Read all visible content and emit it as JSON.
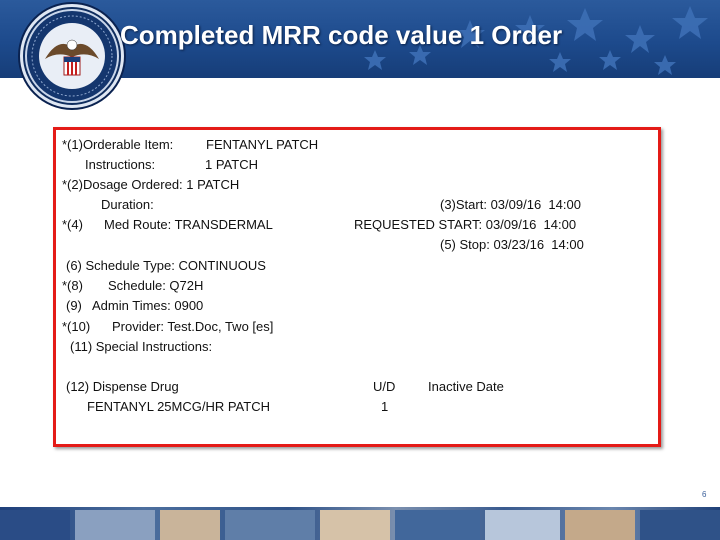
{
  "header": {
    "title": "Completed MRR code value 1 Order",
    "seal_icon": "va-department-seal-icon"
  },
  "order": {
    "line1_prefix": "*(1)Orderable Item:",
    "line1_value": "FENTANYL PATCH",
    "line2_prefix": "Instructions:",
    "line2_value": "1 PATCH",
    "line3": "*(2)Dosage Ordered: 1 PATCH",
    "line4": "Duration:",
    "start": "(3)Start: 03/09/16  14:00",
    "line5_prefix": "*(4)",
    "line5_value": "Med Route: TRANSDERMAL",
    "requested_start": "REQUESTED START: 03/09/16  14:00",
    "stop": "(5) Stop: 03/23/16  14:00",
    "schedule_type": "(6) Schedule Type: CONTINUOUS",
    "schedule_prefix": "*(8)",
    "schedule_value": "Schedule: Q72H",
    "admin_times": "(9)   Admin Times: 0900",
    "provider_prefix": "*(10)",
    "provider_value": "Provider: Test.Doc, Two [es]",
    "special_instructions": "(11) Special Instructions:",
    "dispense_drug_label": "(12) Dispense Drug",
    "ud_label": "U/D",
    "inactive_date_label": "Inactive Date",
    "drug_name": "FENTANYL 25MCG/HR PATCH",
    "ud_value": "1"
  },
  "footer": {
    "page_number": "6"
  },
  "colors": {
    "header_blue": "#1d4a8c",
    "panel_border": "#e41b17"
  }
}
